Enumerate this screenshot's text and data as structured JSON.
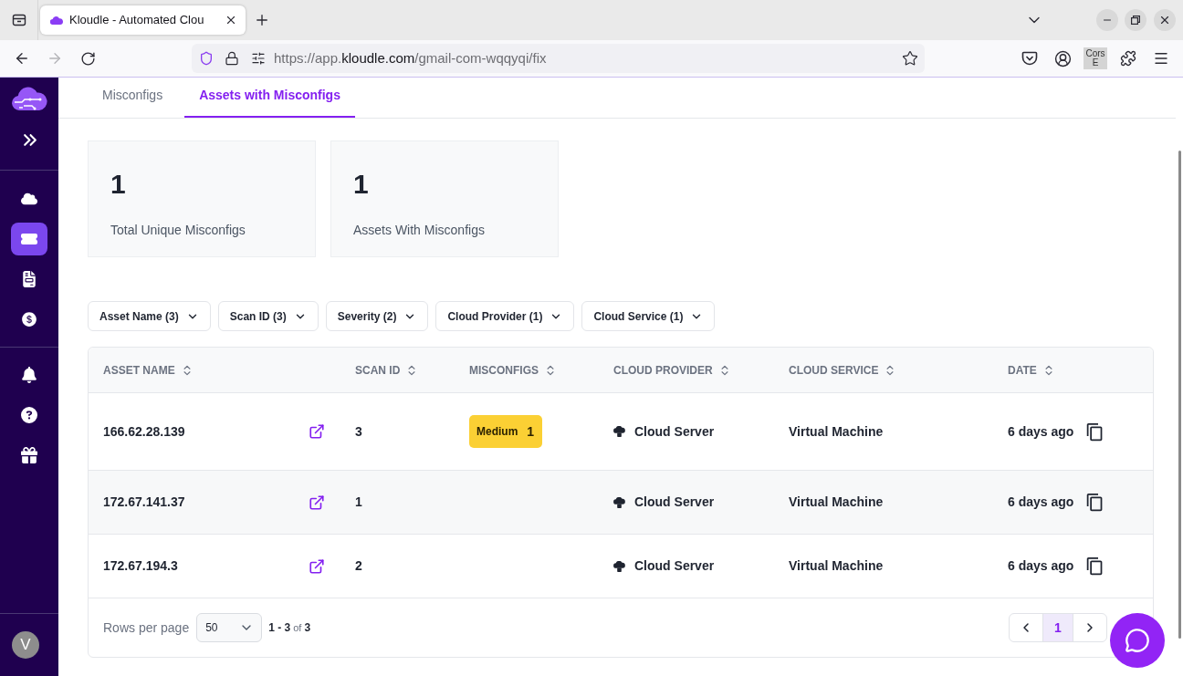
{
  "browser": {
    "tab_title": "Kloudle - Automated Clou",
    "url": {
      "prefix": "https://app.",
      "domain": "kloudle.com",
      "path": "/gmail-com-wqqyqi/fix"
    },
    "extension_badge": {
      "line_1": "Cors",
      "line_2": "E"
    }
  },
  "sidebar": {
    "groups": [
      {
        "items": [
          {
            "selected": false
          },
          {
            "selected": true
          },
          {
            "selected": false
          },
          {
            "selected": false
          }
        ]
      },
      {
        "items": [
          {
            "selected": false
          },
          {
            "selected": false
          },
          {
            "selected": false
          }
        ]
      }
    ],
    "avatar": "V"
  },
  "tabs": [
    {
      "label": "Misconfigs",
      "selected": false
    },
    {
      "label": "Assets with Misconfigs",
      "selected": true
    }
  ],
  "stats": [
    {
      "value": "1",
      "label": "Total Unique Misconfigs"
    },
    {
      "value": "1",
      "label": "Assets With Misconfigs"
    }
  ],
  "filters": [
    "Asset Name (3)",
    "Scan ID (3)",
    "Severity (2)",
    "Cloud Provider (1)",
    "Cloud Service (1)"
  ],
  "table": {
    "columns": [
      "ASSET NAME",
      "SCAN ID",
      "MISCONFIGS",
      "CLOUD PROVIDER",
      "CLOUD SERVICE",
      "DATE"
    ],
    "rows": [
      {
        "asset_name": "166.62.28.139",
        "scan_id": "3",
        "misconfigs": [
          {
            "severity": "Medium",
            "count": "1",
            "color": "#fbd034"
          }
        ],
        "cloud_provider": "Cloud Server",
        "cloud_service": "Virtual Machine",
        "date": "6 days ago"
      },
      {
        "asset_name": "172.67.141.37",
        "scan_id": "1",
        "cloud_provider": "Cloud Server",
        "cloud_service": "Virtual Machine",
        "date": "6 days ago"
      },
      {
        "asset_name": "172.67.194.3",
        "scan_id": "2",
        "cloud_provider": "Cloud Server",
        "cloud_service": "Virtual Machine",
        "date": "6 days ago"
      }
    ],
    "footer": {
      "rows_per_page_label": "Rows per page",
      "rows_per_page": "50",
      "range": "**1 - 3** of **3**",
      "pages": [
        {
          "label": "1",
          "selected": true
        }
      ]
    }
  }
}
